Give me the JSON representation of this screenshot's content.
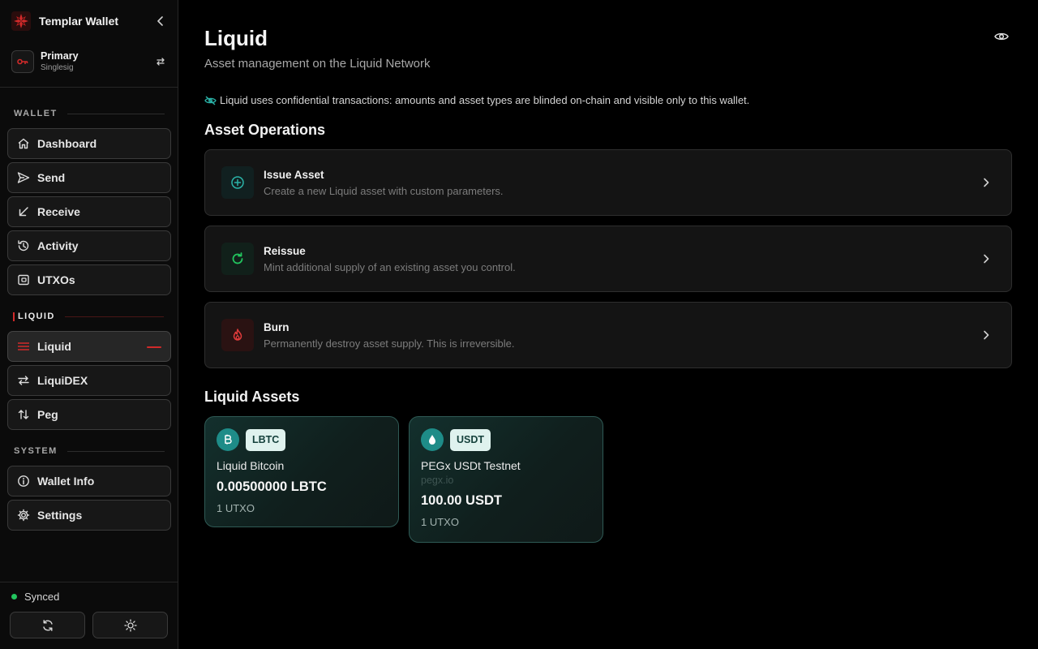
{
  "app": {
    "name": "Templar Wallet"
  },
  "account": {
    "name": "Primary",
    "type": "Singlesig"
  },
  "sidebar": {
    "sections": [
      {
        "title": "WALLET",
        "items": [
          "Dashboard",
          "Send",
          "Receive",
          "Activity",
          "UTXOs"
        ]
      },
      {
        "title": "LIQUID",
        "items": [
          "Liquid",
          "LiquiDEX",
          "Peg"
        ]
      },
      {
        "title": "SYSTEM",
        "items": [
          "Wallet Info",
          "Settings"
        ]
      }
    ],
    "active_item": "Liquid",
    "status": "Synced",
    "colors": {
      "accent": "#d12a2a",
      "synced": "#22c55e"
    }
  },
  "main": {
    "title": "Liquid",
    "subtitle": "Asset management on the Liquid Network",
    "notice": "Liquid uses confidential transactions: amounts and asset types are blinded on-chain and visible only to this wallet.",
    "operations_title": "Asset Operations",
    "operations": [
      {
        "title": "Issue Asset",
        "desc": "Create a new Liquid asset with custom parameters.",
        "icon": "plus-circle-icon"
      },
      {
        "title": "Reissue",
        "desc": "Mint additional supply of an existing asset you control.",
        "icon": "refresh-icon"
      },
      {
        "title": "Burn",
        "desc": "Permanently destroy asset supply. This is irreversible.",
        "icon": "flame-icon"
      }
    ],
    "assets_title": "Liquid Assets",
    "assets": [
      {
        "ticker": "LBTC",
        "name": "Liquid Bitcoin",
        "domain": "",
        "amount": "0.00500000 LBTC",
        "utxos": "1 UTXO",
        "icon": "bitcoin-icon"
      },
      {
        "ticker": "USDT",
        "name": "PEGx USDt Testnet",
        "domain": "pegx.io",
        "amount": "100.00 USDT",
        "utxos": "1 UTXO",
        "icon": "droplet-icon"
      }
    ]
  }
}
